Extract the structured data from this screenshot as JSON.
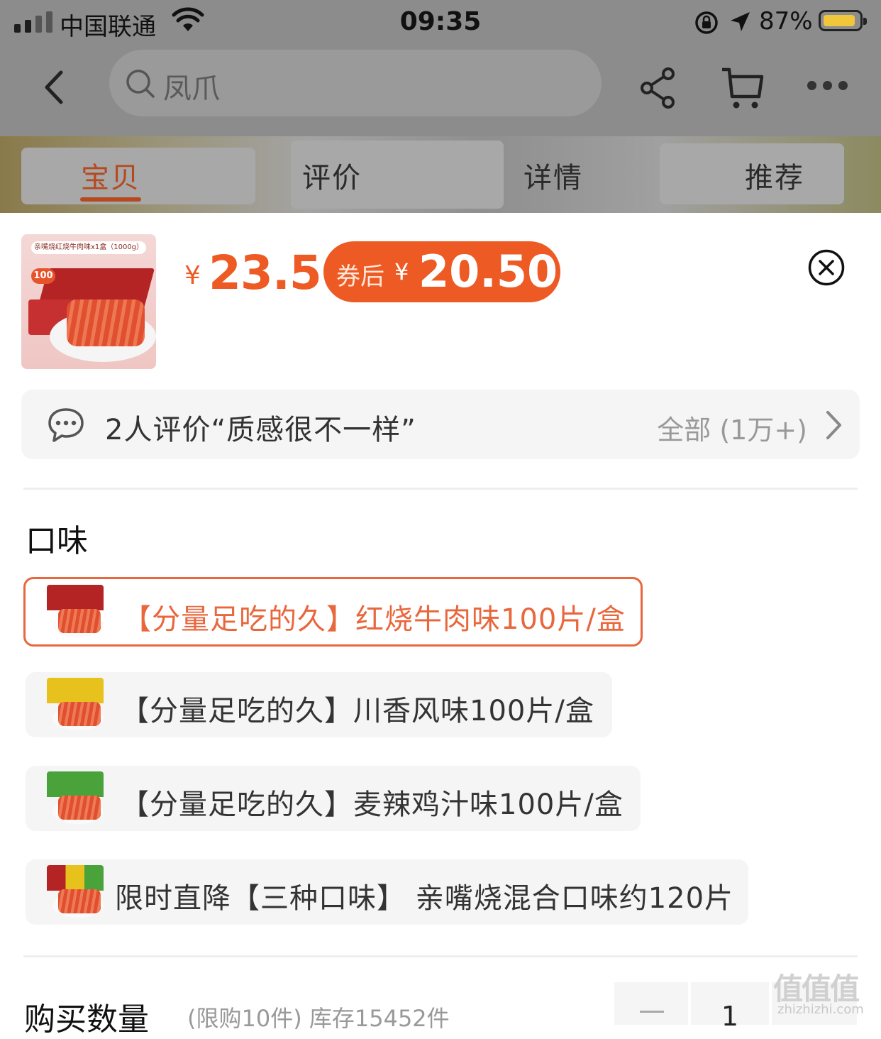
{
  "status_bar": {
    "carrier": "中国联通",
    "time": "09:35",
    "battery_percent": "87%"
  },
  "nav": {
    "search_text": "凤爪"
  },
  "tabs": [
    {
      "label": "宝贝"
    },
    {
      "label": "评价"
    },
    {
      "label": "详情"
    },
    {
      "label": "推荐"
    }
  ],
  "product": {
    "thumb_caption": "亲嘴烧红烧牛肉味x1盒（1000g）",
    "thumb_badge": "100",
    "currency": "¥",
    "price": "23.5",
    "coupon_label": "券后",
    "coupon_currency": "¥",
    "coupon_price": "20.50"
  },
  "review": {
    "text": "2人评价“质感很不一样”",
    "all_label": "全部 (1万+)"
  },
  "flavor": {
    "title": "口味",
    "options": [
      {
        "label": "【分量足吃的久】红烧牛肉味100片/盒",
        "selected": true,
        "color": "#b52424"
      },
      {
        "label": "【分量足吃的久】川香风味100片/盒",
        "selected": false,
        "color": "#e8c21c"
      },
      {
        "label": "【分量足吃的久】麦辣鸡汁味100片/盒",
        "selected": false,
        "color": "#4aa33a"
      },
      {
        "label": "限时直降【三种口味】 亲嘴烧混合口味约120片",
        "selected": false,
        "color": "#d0b020"
      }
    ]
  },
  "quantity": {
    "label": "购买数量",
    "note": "(限购10件) 库存15452件",
    "value": "1"
  },
  "watermark": {
    "logo": "值值值",
    "url": "zhizhizhi.com"
  },
  "colors": {
    "accent": "#ee5a24",
    "tab_active": "#b5491f",
    "selected_border": "#e9673c"
  }
}
